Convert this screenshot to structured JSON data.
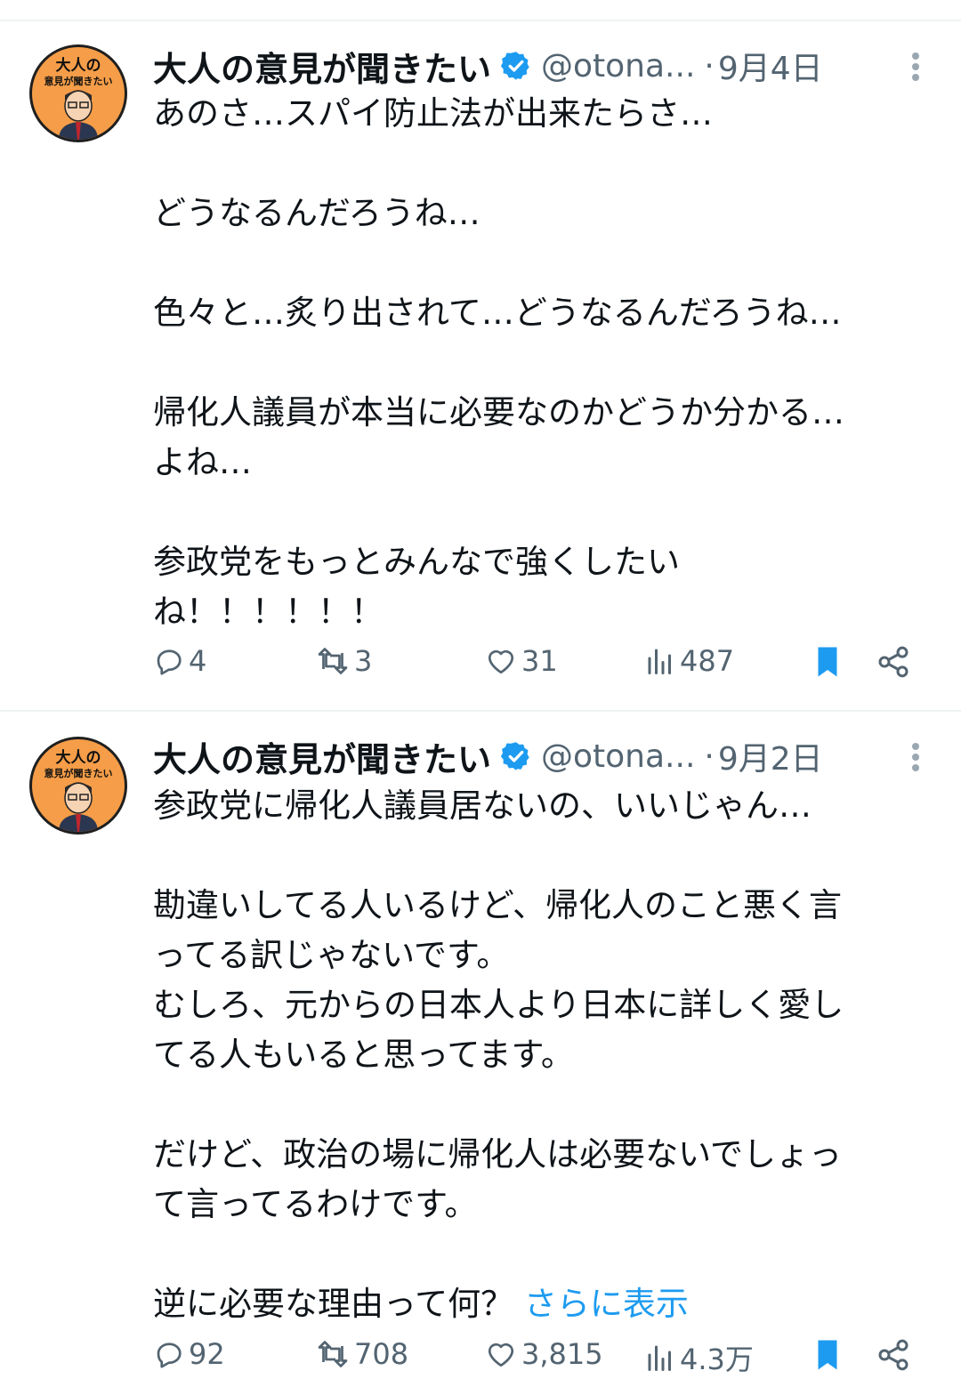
{
  "tweets": [
    {
      "display_name": "大人の意見が聞きたい",
      "handle": "@otona...",
      "separator": "·",
      "date": "9月4日",
      "avatar_text": {
        "line1": "大人の",
        "line2": "意見が聞きたい"
      },
      "body": "あのさ…スパイ防止法が出来たらさ…\n\nどうなるんだろうね…\n\n色々と…炙り出されて…どうなるんだろうね…\n\n帰化人議員が本当に必要なのかどうか分かる…\nよね…\n\n参政党をもっとみんなで強くしたい\nね！！！！！！",
      "show_more": "",
      "replies": "4",
      "retweets": "3",
      "likes": "31",
      "views": "487"
    },
    {
      "display_name": "大人の意見が聞きたい",
      "handle": "@otona...",
      "separator": "·",
      "date": "9月2日",
      "avatar_text": {
        "line1": "大人の",
        "line2": "意見が聞きたい"
      },
      "body": "参政党に帰化人議員居ないの、いいじゃん…\n\n勘違いしてる人いるけど、帰化人のこと悪く言\nってる訳じゃないです。\nむしろ、元からの日本人より日本に詳しく愛し\nてる人もいると思ってます。\n\nだけど、政治の場に帰化人は必要ないでしょっ\nて言ってるわけです。\n\n逆に必要な理由って何？ ",
      "show_more": "さらに表示",
      "replies": "92",
      "retweets": "708",
      "likes": "3,815",
      "views": "4.3万"
    }
  ],
  "colors": {
    "text": "#0f1419",
    "secondary": "#536471",
    "link": "#1d9bf0",
    "verified": "#1d9bf0",
    "bookmark": "#1d9bf0",
    "avatar_bg": "#f59d48"
  },
  "icons": [
    "verified-badge-icon",
    "more-options-icon",
    "reply-icon",
    "retweet-icon",
    "like-icon",
    "views-icon",
    "bookmark-icon",
    "share-icon"
  ]
}
